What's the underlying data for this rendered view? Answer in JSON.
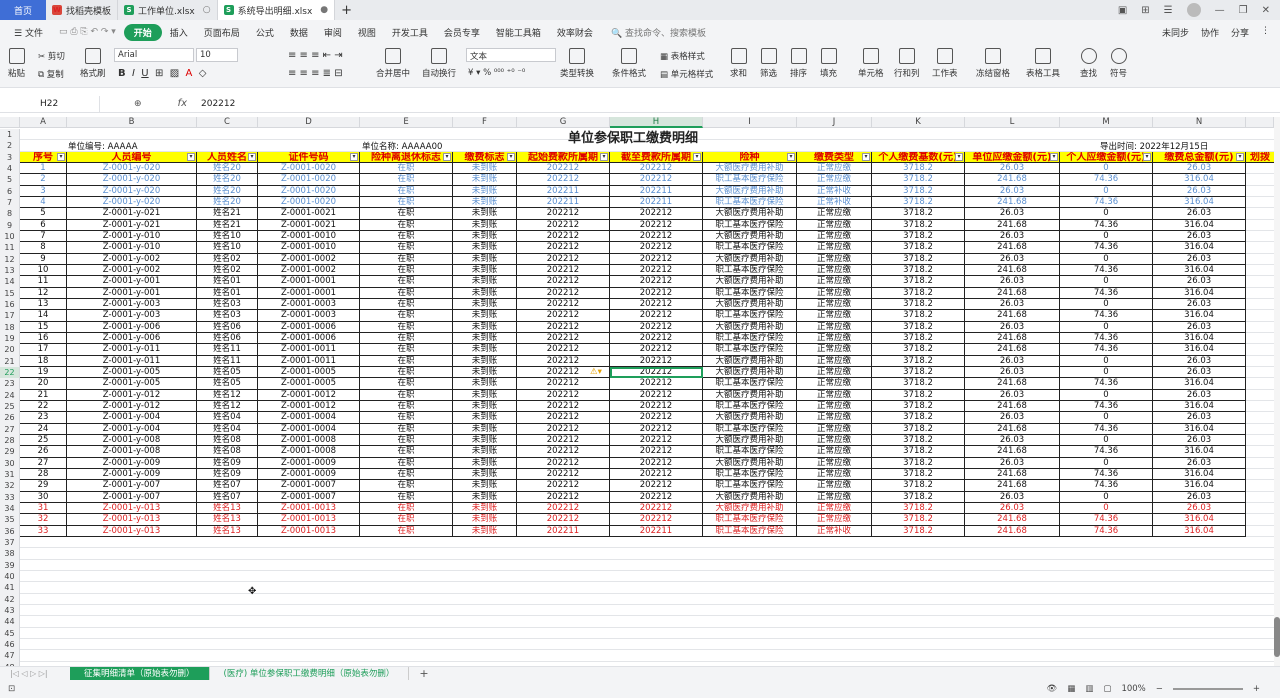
{
  "titlebar": {
    "home": "首页",
    "tabs": [
      {
        "label": "找稻壳模板",
        "icon": "docer-icon"
      },
      {
        "label": "工作单位.xlsx",
        "icon": "sheet-icon"
      },
      {
        "label": "系统导出明细.xlsx",
        "icon": "sheet-icon"
      }
    ]
  },
  "menubar": {
    "file": "文件",
    "items": [
      "开始",
      "插入",
      "页面布局",
      "公式",
      "数据",
      "审阅",
      "视图",
      "开发工具",
      "会员专享",
      "智能工具箱",
      "效率财会"
    ],
    "search": "查找命令、搜索模板",
    "right": [
      "未同步",
      "协作",
      "分享"
    ]
  },
  "ribbon": {
    "paste": "粘贴",
    "cut": "剪切",
    "copy": "复制",
    "format_painter": "格式刷",
    "font_name": "Arial",
    "font_size": "10",
    "merge": "合并居中",
    "wrap": "自动换行",
    "number_format": "文本",
    "type_convert": "类型转换",
    "cond_format": "条件格式",
    "table_style": "表格样式",
    "cell_style": "单元格样式",
    "sum": "求和",
    "filter": "筛选",
    "sort": "排序",
    "fill": "填充",
    "cell": "单元格",
    "row_col": "行和列",
    "worksheet": "工作表",
    "freeze": "冻结窗格",
    "table_tools": "表格工具",
    "find": "查找",
    "symbol": "符号"
  },
  "formula_bar": {
    "cell_ref": "H22",
    "fx": "fx",
    "value": "202212"
  },
  "columns": [
    "A",
    "B",
    "C",
    "D",
    "E",
    "F",
    "G",
    "H",
    "I",
    "J",
    "K",
    "L",
    "M",
    "N"
  ],
  "sheet": {
    "title": "单位参保职工缴费明细",
    "unit_code": "单位编号: AAAAA",
    "unit_name": "单位名称: AAAAA00",
    "export_time": "导出时间: 2022年12月15日",
    "headers": [
      "序号",
      "人员编号",
      "人员姓名",
      "证件号码",
      "险种离退休标志",
      "缴费标志",
      "起始费款所属期",
      "截至费款所属期",
      "险种",
      "缴费类型",
      "个人缴费基数(元)",
      "单位应缴金额(元)",
      "个人应缴金额(元)",
      "缴费总金额(元)"
    ],
    "extra_header": "划拨",
    "rows": [
      {
        "c": "blue",
        "v": [
          "1",
          "Z-0001-y-020",
          "姓名20",
          "Z-0001-0020",
          "在职",
          "未到账",
          "202212",
          "202212",
          "大额医疗费用补助",
          "正常应缴",
          "3718.2",
          "26.03",
          "0",
          "26.03"
        ]
      },
      {
        "c": "blue",
        "v": [
          "2",
          "Z-0001-y-020",
          "姓名20",
          "Z-0001-0020",
          "在职",
          "未到账",
          "202212",
          "202212",
          "职工基本医疗保险",
          "正常应缴",
          "3718.2",
          "241.68",
          "74.36",
          "316.04"
        ]
      },
      {
        "c": "blue",
        "v": [
          "3",
          "Z-0001-y-020",
          "姓名20",
          "Z-0001-0020",
          "在职",
          "未到账",
          "202211",
          "202211",
          "大额医疗费用补助",
          "正常补收",
          "3718.2",
          "26.03",
          "0",
          "26.03"
        ]
      },
      {
        "c": "blue",
        "v": [
          "4",
          "Z-0001-y-020",
          "姓名20",
          "Z-0001-0020",
          "在职",
          "未到账",
          "202211",
          "202211",
          "职工基本医疗保险",
          "正常补收",
          "3718.2",
          "241.68",
          "74.36",
          "316.04"
        ]
      },
      {
        "c": "blk",
        "v": [
          "5",
          "Z-0001-y-021",
          "姓名21",
          "Z-0001-0021",
          "在职",
          "未到账",
          "202212",
          "202212",
          "大额医疗费用补助",
          "正常应缴",
          "3718.2",
          "26.03",
          "0",
          "26.03"
        ]
      },
      {
        "c": "blk",
        "v": [
          "6",
          "Z-0001-y-021",
          "姓名21",
          "Z-0001-0021",
          "在职",
          "未到账",
          "202212",
          "202212",
          "职工基本医疗保险",
          "正常应缴",
          "3718.2",
          "241.68",
          "74.36",
          "316.04"
        ]
      },
      {
        "c": "blk",
        "v": [
          "7",
          "Z-0001-y-010",
          "姓名10",
          "Z-0001-0010",
          "在职",
          "未到账",
          "202212",
          "202212",
          "大额医疗费用补助",
          "正常应缴",
          "3718.2",
          "26.03",
          "0",
          "26.03"
        ]
      },
      {
        "c": "blk",
        "v": [
          "8",
          "Z-0001-y-010",
          "姓名10",
          "Z-0001-0010",
          "在职",
          "未到账",
          "202212",
          "202212",
          "职工基本医疗保险",
          "正常应缴",
          "3718.2",
          "241.68",
          "74.36",
          "316.04"
        ]
      },
      {
        "c": "blk",
        "v": [
          "9",
          "Z-0001-y-002",
          "姓名02",
          "Z-0001-0002",
          "在职",
          "未到账",
          "202212",
          "202212",
          "大额医疗费用补助",
          "正常应缴",
          "3718.2",
          "26.03",
          "0",
          "26.03"
        ]
      },
      {
        "c": "blk",
        "v": [
          "10",
          "Z-0001-y-002",
          "姓名02",
          "Z-0001-0002",
          "在职",
          "未到账",
          "202212",
          "202212",
          "职工基本医疗保险",
          "正常应缴",
          "3718.2",
          "241.68",
          "74.36",
          "316.04"
        ]
      },
      {
        "c": "blk",
        "v": [
          "11",
          "Z-0001-y-001",
          "姓名01",
          "Z-0001-0001",
          "在职",
          "未到账",
          "202212",
          "202212",
          "大额医疗费用补助",
          "正常应缴",
          "3718.2",
          "26.03",
          "0",
          "26.03"
        ]
      },
      {
        "c": "blk",
        "v": [
          "12",
          "Z-0001-y-001",
          "姓名01",
          "Z-0001-0001",
          "在职",
          "未到账",
          "202212",
          "202212",
          "职工基本医疗保险",
          "正常应缴",
          "3718.2",
          "241.68",
          "74.36",
          "316.04"
        ]
      },
      {
        "c": "blk",
        "v": [
          "13",
          "Z-0001-y-003",
          "姓名03",
          "Z-0001-0003",
          "在职",
          "未到账",
          "202212",
          "202212",
          "大额医疗费用补助",
          "正常应缴",
          "3718.2",
          "26.03",
          "0",
          "26.03"
        ]
      },
      {
        "c": "blk",
        "v": [
          "14",
          "Z-0001-y-003",
          "姓名03",
          "Z-0001-0003",
          "在职",
          "未到账",
          "202212",
          "202212",
          "职工基本医疗保险",
          "正常应缴",
          "3718.2",
          "241.68",
          "74.36",
          "316.04"
        ]
      },
      {
        "c": "blk",
        "v": [
          "15",
          "Z-0001-y-006",
          "姓名06",
          "Z-0001-0006",
          "在职",
          "未到账",
          "202212",
          "202212",
          "大额医疗费用补助",
          "正常应缴",
          "3718.2",
          "26.03",
          "0",
          "26.03"
        ]
      },
      {
        "c": "blk",
        "v": [
          "16",
          "Z-0001-y-006",
          "姓名06",
          "Z-0001-0006",
          "在职",
          "未到账",
          "202212",
          "202212",
          "职工基本医疗保险",
          "正常应缴",
          "3718.2",
          "241.68",
          "74.36",
          "316.04"
        ]
      },
      {
        "c": "blk",
        "v": [
          "17",
          "Z-0001-y-011",
          "姓名11",
          "Z-0001-0011",
          "在职",
          "未到账",
          "202212",
          "202212",
          "职工基本医疗保险",
          "正常应缴",
          "3718.2",
          "241.68",
          "74.36",
          "316.04"
        ]
      },
      {
        "c": "blk",
        "v": [
          "18",
          "Z-0001-y-011",
          "姓名11",
          "Z-0001-0011",
          "在职",
          "未到账",
          "202212",
          "202212",
          "大额医疗费用补助",
          "正常应缴",
          "3718.2",
          "26.03",
          "0",
          "26.03"
        ]
      },
      {
        "c": "blk",
        "v": [
          "19",
          "Z-0001-y-005",
          "姓名05",
          "Z-0001-0005",
          "在职",
          "未到账",
          "202212",
          "202212",
          "大额医疗费用补助",
          "正常应缴",
          "3718.2",
          "26.03",
          "0",
          "26.03"
        ]
      },
      {
        "c": "blk",
        "v": [
          "20",
          "Z-0001-y-005",
          "姓名05",
          "Z-0001-0005",
          "在职",
          "未到账",
          "202212",
          "202212",
          "职工基本医疗保险",
          "正常应缴",
          "3718.2",
          "241.68",
          "74.36",
          "316.04"
        ]
      },
      {
        "c": "blk",
        "v": [
          "21",
          "Z-0001-y-012",
          "姓名12",
          "Z-0001-0012",
          "在职",
          "未到账",
          "202212",
          "202212",
          "大额医疗费用补助",
          "正常应缴",
          "3718.2",
          "26.03",
          "0",
          "26.03"
        ]
      },
      {
        "c": "blk",
        "v": [
          "22",
          "Z-0001-y-012",
          "姓名12",
          "Z-0001-0012",
          "在职",
          "未到账",
          "202212",
          "202212",
          "职工基本医疗保险",
          "正常应缴",
          "3718.2",
          "241.68",
          "74.36",
          "316.04"
        ]
      },
      {
        "c": "blk",
        "v": [
          "23",
          "Z-0001-y-004",
          "姓名04",
          "Z-0001-0004",
          "在职",
          "未到账",
          "202212",
          "202212",
          "大额医疗费用补助",
          "正常应缴",
          "3718.2",
          "26.03",
          "0",
          "26.03"
        ]
      },
      {
        "c": "blk",
        "v": [
          "24",
          "Z-0001-y-004",
          "姓名04",
          "Z-0001-0004",
          "在职",
          "未到账",
          "202212",
          "202212",
          "职工基本医疗保险",
          "正常应缴",
          "3718.2",
          "241.68",
          "74.36",
          "316.04"
        ]
      },
      {
        "c": "blk",
        "v": [
          "25",
          "Z-0001-y-008",
          "姓名08",
          "Z-0001-0008",
          "在职",
          "未到账",
          "202212",
          "202212",
          "大额医疗费用补助",
          "正常应缴",
          "3718.2",
          "26.03",
          "0",
          "26.03"
        ]
      },
      {
        "c": "blk",
        "v": [
          "26",
          "Z-0001-y-008",
          "姓名08",
          "Z-0001-0008",
          "在职",
          "未到账",
          "202212",
          "202212",
          "职工基本医疗保险",
          "正常应缴",
          "3718.2",
          "241.68",
          "74.36",
          "316.04"
        ]
      },
      {
        "c": "blk",
        "v": [
          "27",
          "Z-0001-y-009",
          "姓名09",
          "Z-0001-0009",
          "在职",
          "未到账",
          "202212",
          "202212",
          "大额医疗费用补助",
          "正常应缴",
          "3718.2",
          "26.03",
          "0",
          "26.03"
        ]
      },
      {
        "c": "blk",
        "v": [
          "28",
          "Z-0001-y-009",
          "姓名09",
          "Z-0001-0009",
          "在职",
          "未到账",
          "202212",
          "202212",
          "职工基本医疗保险",
          "正常应缴",
          "3718.2",
          "241.68",
          "74.36",
          "316.04"
        ]
      },
      {
        "c": "blk",
        "v": [
          "29",
          "Z-0001-y-007",
          "姓名07",
          "Z-0001-0007",
          "在职",
          "未到账",
          "202212",
          "202212",
          "职工基本医疗保险",
          "正常应缴",
          "3718.2",
          "241.68",
          "74.36",
          "316.04"
        ]
      },
      {
        "c": "blk",
        "v": [
          "30",
          "Z-0001-y-007",
          "姓名07",
          "Z-0001-0007",
          "在职",
          "未到账",
          "202212",
          "202212",
          "大额医疗费用补助",
          "正常应缴",
          "3718.2",
          "26.03",
          "0",
          "26.03"
        ]
      },
      {
        "c": "red",
        "v": [
          "31",
          "Z-0001-y-013",
          "姓名13",
          "Z-0001-0013",
          "在职",
          "未到账",
          "202212",
          "202212",
          "大额医疗费用补助",
          "正常应缴",
          "3718.2",
          "26.03",
          "0",
          "26.03"
        ]
      },
      {
        "c": "red",
        "v": [
          "32",
          "Z-0001-y-013",
          "姓名13",
          "Z-0001-0013",
          "在职",
          "未到账",
          "202212",
          "202212",
          "职工基本医疗保险",
          "正常应缴",
          "3718.2",
          "241.68",
          "74.36",
          "316.04"
        ]
      },
      {
        "c": "red",
        "v": [
          "33",
          "Z-0001-y-013",
          "姓名13",
          "Z-0001-0013",
          "在职",
          "未到账",
          "202211",
          "202211",
          "职工基本医疗保险",
          "正常补收",
          "3718.2",
          "241.68",
          "74.36",
          "316.04"
        ]
      }
    ]
  },
  "row_numbers_empty": [
    "37",
    "38",
    "39",
    "40",
    "41",
    "42",
    "43",
    "44",
    "45",
    "46",
    "47",
    "48"
  ],
  "sheet_tabs": [
    "征集明细清单（原始表勿删）",
    "(医疗) 单位参保职工缴费明细（原始表勿删）"
  ],
  "status": {
    "zoom": "100%"
  },
  "colors": {
    "accent": "#1e9e5a",
    "header_fill": "#ffff00",
    "header_text": "#dd0000",
    "blue_rows": "#5a8fd0",
    "red_rows": "#dd2222"
  }
}
